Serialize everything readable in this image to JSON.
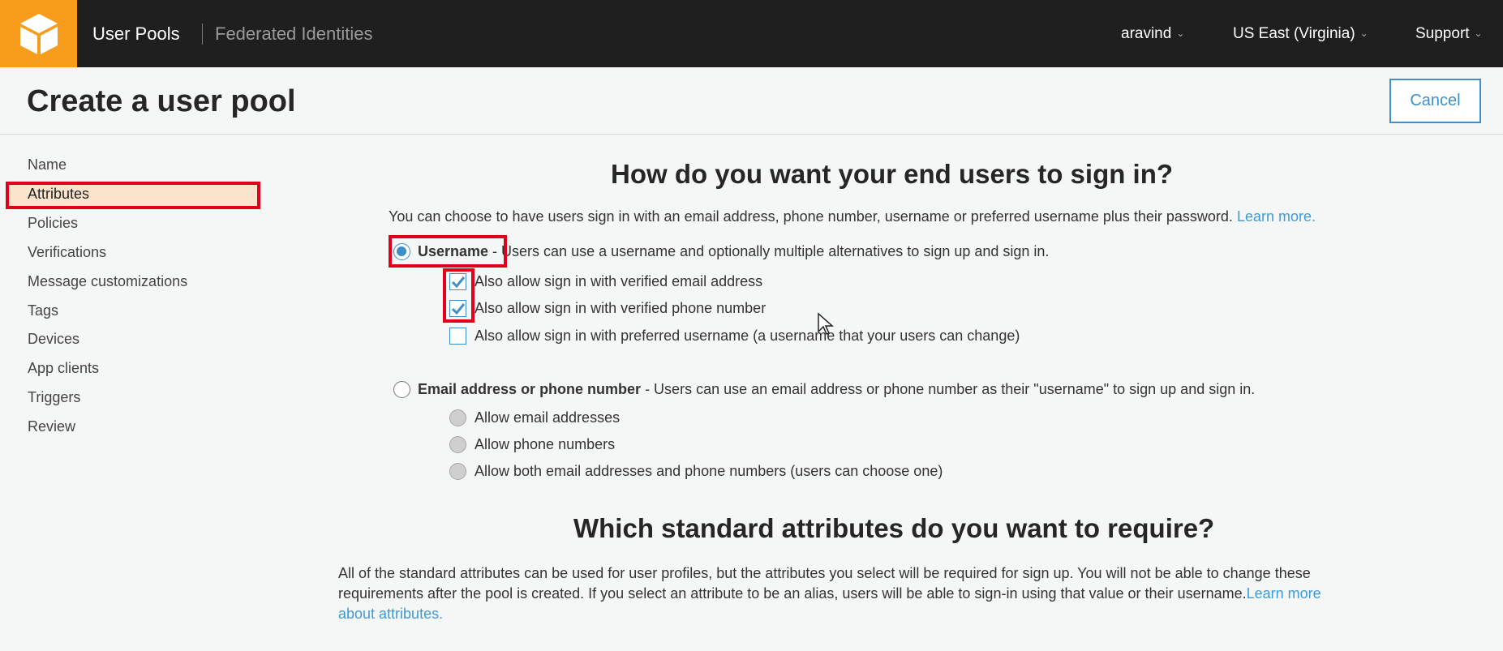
{
  "topbar": {
    "user_pools": "User Pools",
    "federated": "Federated Identities",
    "user": "aravind",
    "region": "US East (Virginia)",
    "support": "Support"
  },
  "header": {
    "title": "Create a user pool",
    "cancel_label": "Cancel"
  },
  "sidebar": {
    "items": [
      {
        "label": "Name"
      },
      {
        "label": "Attributes",
        "active": true
      },
      {
        "label": "Policies"
      },
      {
        "label": "Verifications"
      },
      {
        "label": "Message customizations"
      },
      {
        "label": "Tags"
      },
      {
        "label": "Devices"
      },
      {
        "label": "App clients"
      },
      {
        "label": "Triggers"
      },
      {
        "label": "Review"
      }
    ]
  },
  "signin": {
    "heading": "How do you want your end users to sign in?",
    "intro": "You can choose to have users sign in with an email address, phone number, username or preferred username plus their password. ",
    "learn_more": "Learn more.",
    "username_option": {
      "label": "Username",
      "desc": " - Users can use a username and optionally multiple alternatives to sign up and sign in.",
      "selected": true,
      "suboptions": [
        {
          "label": "Also allow sign in with verified email address",
          "checked": true
        },
        {
          "label": "Also allow sign in with verified phone number",
          "checked": true
        },
        {
          "label": "Also allow sign in with preferred username (a username that your users can change)",
          "checked": false
        }
      ]
    },
    "email_option": {
      "label": "Email address or phone number",
      "desc": " - Users can use an email address or phone number as their \"username\" to sign up and sign in.",
      "selected": false,
      "suboptions": [
        {
          "label": "Allow email addresses"
        },
        {
          "label": "Allow phone numbers"
        },
        {
          "label": "Allow both email addresses and phone numbers (users can choose one)"
        }
      ]
    }
  },
  "attributes": {
    "heading": "Which standard attributes do you want to require?",
    "line1": "All of the standard attributes can be used for user profiles, but the attributes you select will be required for sign up. You will not be able to change these",
    "line2": "requirements after the pool is created. If you select an attribute to be an alias, users will be able to sign-in using that value or their username.",
    "link_a": "Learn more",
    "link_b": "about attributes."
  },
  "colors": {
    "accent": "#3e8fc8",
    "link": "#3e9ad6",
    "highlight": "#e0001b",
    "logo": "#f79c1b"
  }
}
